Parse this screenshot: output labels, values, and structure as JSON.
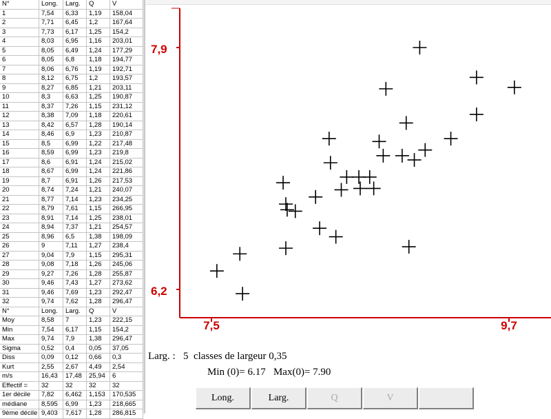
{
  "table": {
    "header": [
      "N°",
      "Long.",
      "Larg.",
      "Q",
      "V"
    ],
    "rows": [
      [
        "1",
        "7,54",
        "6,33",
        "1,19",
        "158,04"
      ],
      [
        "2",
        "7,71",
        "6,45",
        "1,2",
        "167,64"
      ],
      [
        "3",
        "7,73",
        "6,17",
        "1,25",
        "154,2"
      ],
      [
        "4",
        "8,03",
        "6,95",
        "1,16",
        "203,01"
      ],
      [
        "5",
        "8,05",
        "6,49",
        "1,24",
        "177,29"
      ],
      [
        "6",
        "8,05",
        "6,8",
        "1,18",
        "194,77"
      ],
      [
        "7",
        "8,06",
        "6,76",
        "1,19",
        "192,71"
      ],
      [
        "8",
        "8,12",
        "6,75",
        "1,2",
        "193,57"
      ],
      [
        "9",
        "8,27",
        "6,85",
        "1,21",
        "203,11"
      ],
      [
        "10",
        "8,3",
        "6,63",
        "1,25",
        "190,87"
      ],
      [
        "11",
        "8,37",
        "7,26",
        "1,15",
        "231,12"
      ],
      [
        "12",
        "8,38",
        "7,09",
        "1,18",
        "220,61"
      ],
      [
        "13",
        "8,42",
        "6,57",
        "1,28",
        "190,14"
      ],
      [
        "14",
        "8,46",
        "6,9",
        "1,23",
        "210,87"
      ],
      [
        "15",
        "8,5",
        "6,99",
        "1,22",
        "217,48"
      ],
      [
        "16",
        "8,59",
        "6,99",
        "1,23",
        "219,8"
      ],
      [
        "17",
        "8,6",
        "6,91",
        "1,24",
        "215,02"
      ],
      [
        "18",
        "8,67",
        "6,99",
        "1,24",
        "221,86"
      ],
      [
        "19",
        "8,7",
        "6,91",
        "1,26",
        "217,53"
      ],
      [
        "20",
        "8,74",
        "7,24",
        "1,21",
        "240,07"
      ],
      [
        "21",
        "8,77",
        "7,14",
        "1,23",
        "234,25"
      ],
      [
        "22",
        "8,79",
        "7,61",
        "1,15",
        "266,95"
      ],
      [
        "23",
        "8,91",
        "7,14",
        "1,25",
        "238,01"
      ],
      [
        "24",
        "8,94",
        "7,37",
        "1,21",
        "254,57"
      ],
      [
        "25",
        "8,96",
        "6,5",
        "1,38",
        "198,09"
      ],
      [
        "26",
        "9",
        "7,11",
        "1,27",
        "238,4"
      ],
      [
        "27",
        "9,04",
        "7,9",
        "1,15",
        "295,31"
      ],
      [
        "28",
        "9,08",
        "7,18",
        "1,26",
        "245,06"
      ],
      [
        "29",
        "9,27",
        "7,26",
        "1,28",
        "255,87"
      ],
      [
        "30",
        "9,46",
        "7,43",
        "1,27",
        "273,62"
      ],
      [
        "31",
        "9,46",
        "7,69",
        "1,23",
        "292,47"
      ],
      [
        "32",
        "9,74",
        "7,62",
        "1,28",
        "296,47"
      ]
    ],
    "header2": [
      "N°",
      "Long.",
      "Larg.",
      "Q",
      "V"
    ],
    "stats": [
      [
        "Moy",
        "8,58",
        "7",
        "1,23",
        "222,15"
      ],
      [
        "Min",
        "7,54",
        "6,17",
        "1,15",
        "154,2"
      ],
      [
        "Max",
        "9,74",
        "7,9",
        "1,38",
        "296,47"
      ],
      [
        "Sigma",
        "0,52",
        "0,4",
        "0,05",
        "37,05"
      ],
      [
        "Diss",
        "0,09",
        "0,12",
        "0,66",
        "0,3"
      ],
      [
        "Kurt",
        "2,55",
        "2,67",
        "4,49",
        "2,54"
      ],
      [
        "m/s",
        "16,43",
        "17,48",
        "25,94",
        "6"
      ],
      [
        "Effectif =",
        "32",
        "32",
        "32",
        "32"
      ],
      [
        "1er décile",
        "7,82",
        "6,462",
        "1,153",
        "170,535"
      ],
      [
        "médiane",
        "8,595",
        "6,99",
        "1,23",
        "218,665"
      ],
      [
        "9ème décile",
        "9,403",
        "7,617",
        "1,28",
        "286,815"
      ]
    ]
  },
  "chart_data": {
    "type": "scatter",
    "title": "",
    "xlabel": "",
    "ylabel": "",
    "xlim": [
      7.5,
      9.7
    ],
    "ylim": [
      6.2,
      7.9
    ],
    "x_ticks": [
      "7,5",
      "9,7"
    ],
    "y_ticks": [
      "7,9",
      "6,2"
    ],
    "axis_color": "#cc0000",
    "marker": "plus",
    "points": [
      [
        7.54,
        6.33
      ],
      [
        7.71,
        6.45
      ],
      [
        7.73,
        6.17
      ],
      [
        8.03,
        6.95
      ],
      [
        8.05,
        6.49
      ],
      [
        8.05,
        6.8
      ],
      [
        8.06,
        6.76
      ],
      [
        8.12,
        6.75
      ],
      [
        8.27,
        6.85
      ],
      [
        8.3,
        6.63
      ],
      [
        8.37,
        7.26
      ],
      [
        8.38,
        7.09
      ],
      [
        8.42,
        6.57
      ],
      [
        8.46,
        6.9
      ],
      [
        8.5,
        6.99
      ],
      [
        8.59,
        6.99
      ],
      [
        8.6,
        6.91
      ],
      [
        8.67,
        6.99
      ],
      [
        8.7,
        6.91
      ],
      [
        8.74,
        7.24
      ],
      [
        8.77,
        7.14
      ],
      [
        8.79,
        7.61
      ],
      [
        8.91,
        7.14
      ],
      [
        8.94,
        7.37
      ],
      [
        8.96,
        6.5
      ],
      [
        9.0,
        7.11
      ],
      [
        9.04,
        7.9
      ],
      [
        9.08,
        7.18
      ],
      [
        9.27,
        7.26
      ],
      [
        9.46,
        7.43
      ],
      [
        9.46,
        7.69
      ],
      [
        9.74,
        7.62
      ]
    ]
  },
  "info": {
    "line1_label": "Larg. :",
    "line1_text": "5  classes de largeur 0,35",
    "line2_text": "Min (0)= 6.17   Max(0)= 7.90"
  },
  "buttons": [
    {
      "label": "Long.",
      "enabled": true
    },
    {
      "label": "Larg.",
      "enabled": true
    },
    {
      "label": "Q",
      "enabled": false
    },
    {
      "label": "V",
      "enabled": false
    },
    {
      "label": "",
      "enabled": false
    }
  ]
}
